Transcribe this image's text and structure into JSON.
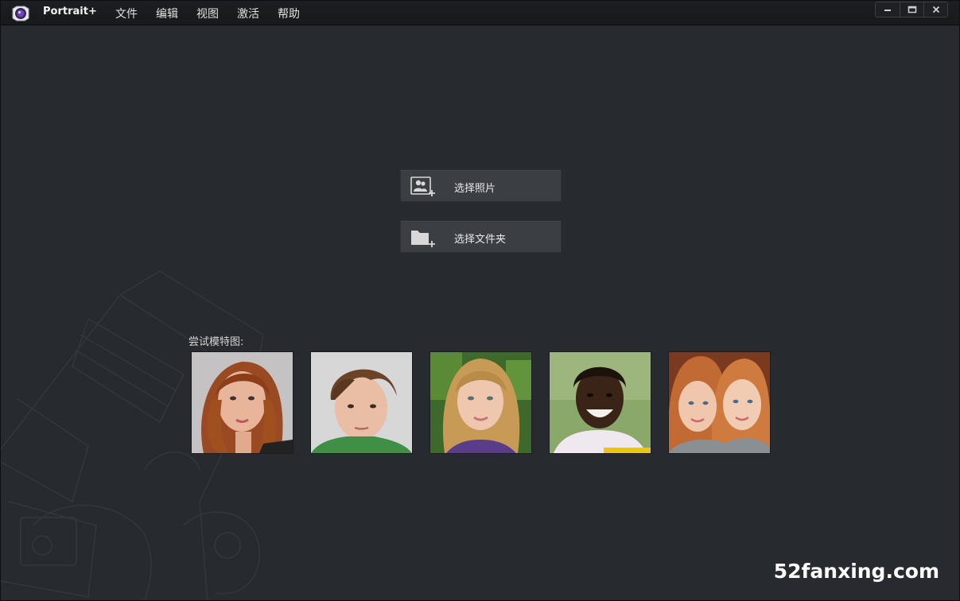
{
  "app": {
    "name": "Portrait+"
  },
  "menu": {
    "items": [
      {
        "label": "文件"
      },
      {
        "label": "编辑"
      },
      {
        "label": "视图"
      },
      {
        "label": "激活"
      },
      {
        "label": "帮助"
      }
    ]
  },
  "window_controls": {
    "icons": [
      "minimize-icon",
      "maximize-icon",
      "close-icon"
    ]
  },
  "actions": {
    "select_photo": {
      "label": "选择照片",
      "icon": "add-photo-icon"
    },
    "select_folder": {
      "label": "选择文件夹",
      "icon": "add-folder-icon"
    }
  },
  "samples": {
    "label": "尝试模特图:",
    "images": [
      "woman-redhead",
      "boy-brown-hair",
      "girl-blonde",
      "girl-smiling",
      "two-girls"
    ]
  },
  "watermark": "52fanxing.com",
  "colors": {
    "background": "#272a2e",
    "titlebar": "#17191b",
    "button": "#3b3e42",
    "text": "#e6e6e6"
  }
}
